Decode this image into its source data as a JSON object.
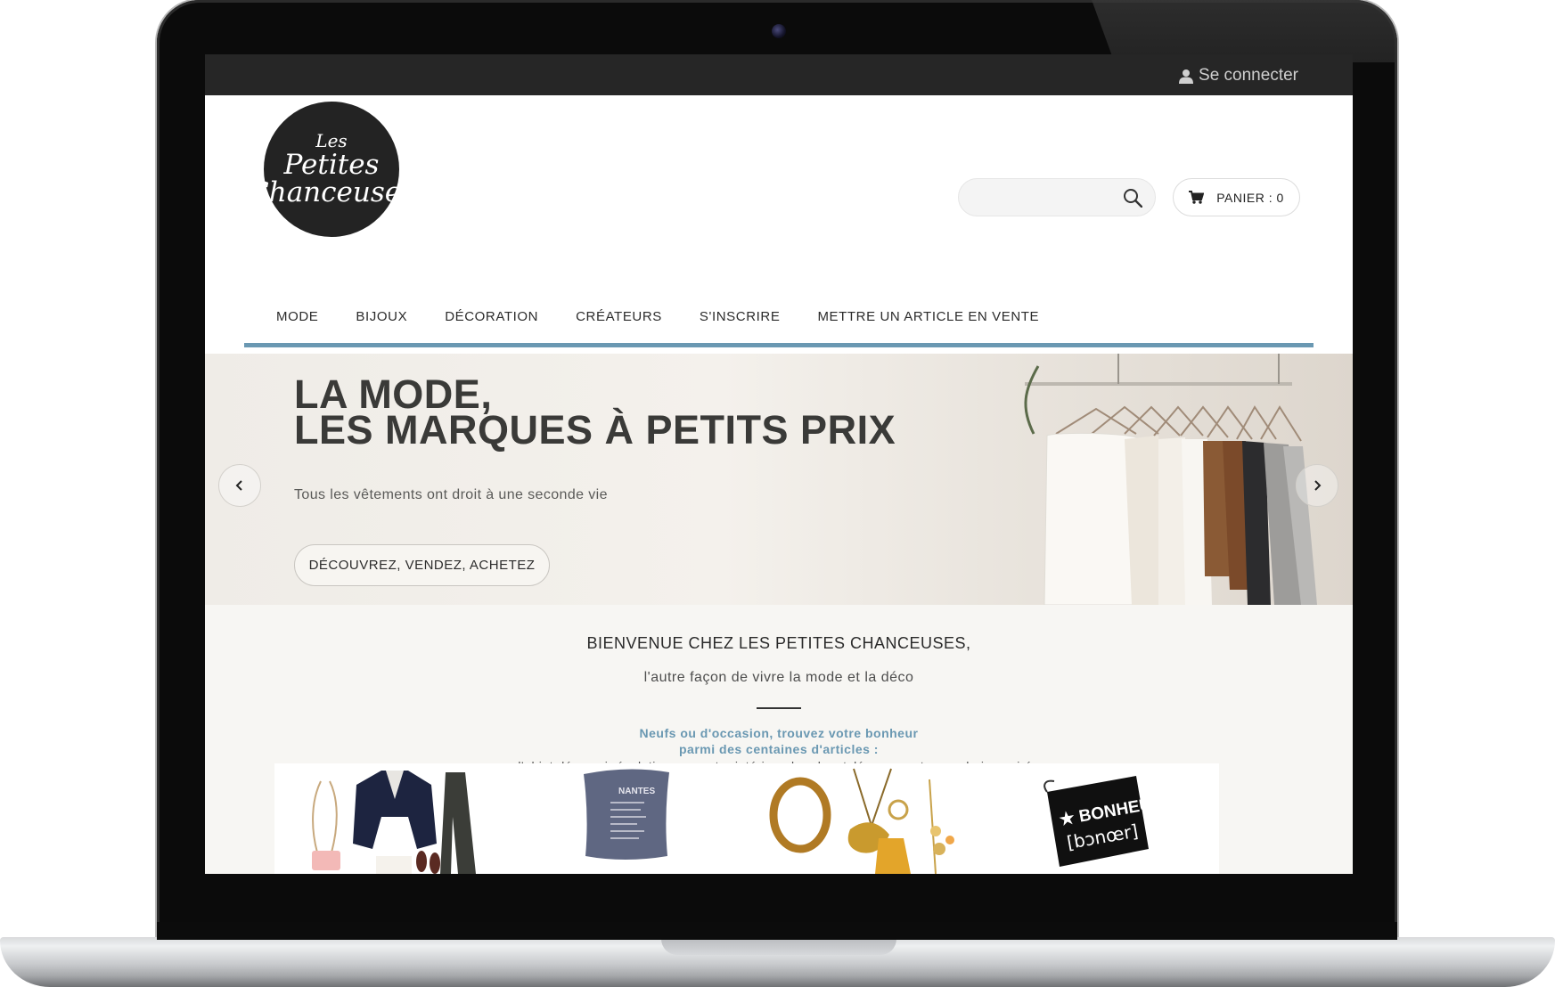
{
  "topbar": {
    "login_label": "Se connecter"
  },
  "logo": {
    "line1": "Les",
    "line2": "Petites",
    "line3": "Chanceuses"
  },
  "search": {
    "placeholder": ""
  },
  "cart": {
    "label": "PANIER : 0"
  },
  "nav": {
    "items": [
      {
        "label": "MODE"
      },
      {
        "label": "BIJOUX"
      },
      {
        "label": "DÉCORATION"
      },
      {
        "label": "CRÉATEURS"
      },
      {
        "label": "S'INSCRIRE"
      },
      {
        "label": "METTRE UN ARTICLE EN VENTE"
      }
    ],
    "accent_color": "#6a98b2"
  },
  "hero": {
    "title_line1": "LA MODE,",
    "title_line2": "LES MARQUES À PETITS PRIX",
    "subtitle": "Tous les vêtements ont droit à une seconde vie",
    "cta_label": "DÉCOUVREZ, VENDEZ, ACHETEZ"
  },
  "welcome": {
    "title": "BIENVENUE CHEZ LES PETITES CHANCEUSES,",
    "tagline": "l'autre façon de vivre la mode et la déco",
    "highlight_line1": "Neufs ou d'occasion, trouvez votre bonheur",
    "highlight_line2": "parmi des centaines d'articles :",
    "description": "l'objet déco qui révolutionnera votre intérieur, la robe stylée pour votre prochaine soirée"
  },
  "products": {
    "pouch_line1": "★ BONHEUR",
    "pouch_line2": "[bɔnœr]",
    "cushion_title": "NANTES"
  },
  "icons": [
    "user-icon",
    "search-icon",
    "cart-icon",
    "chevron-left-icon",
    "chevron-right-icon"
  ]
}
